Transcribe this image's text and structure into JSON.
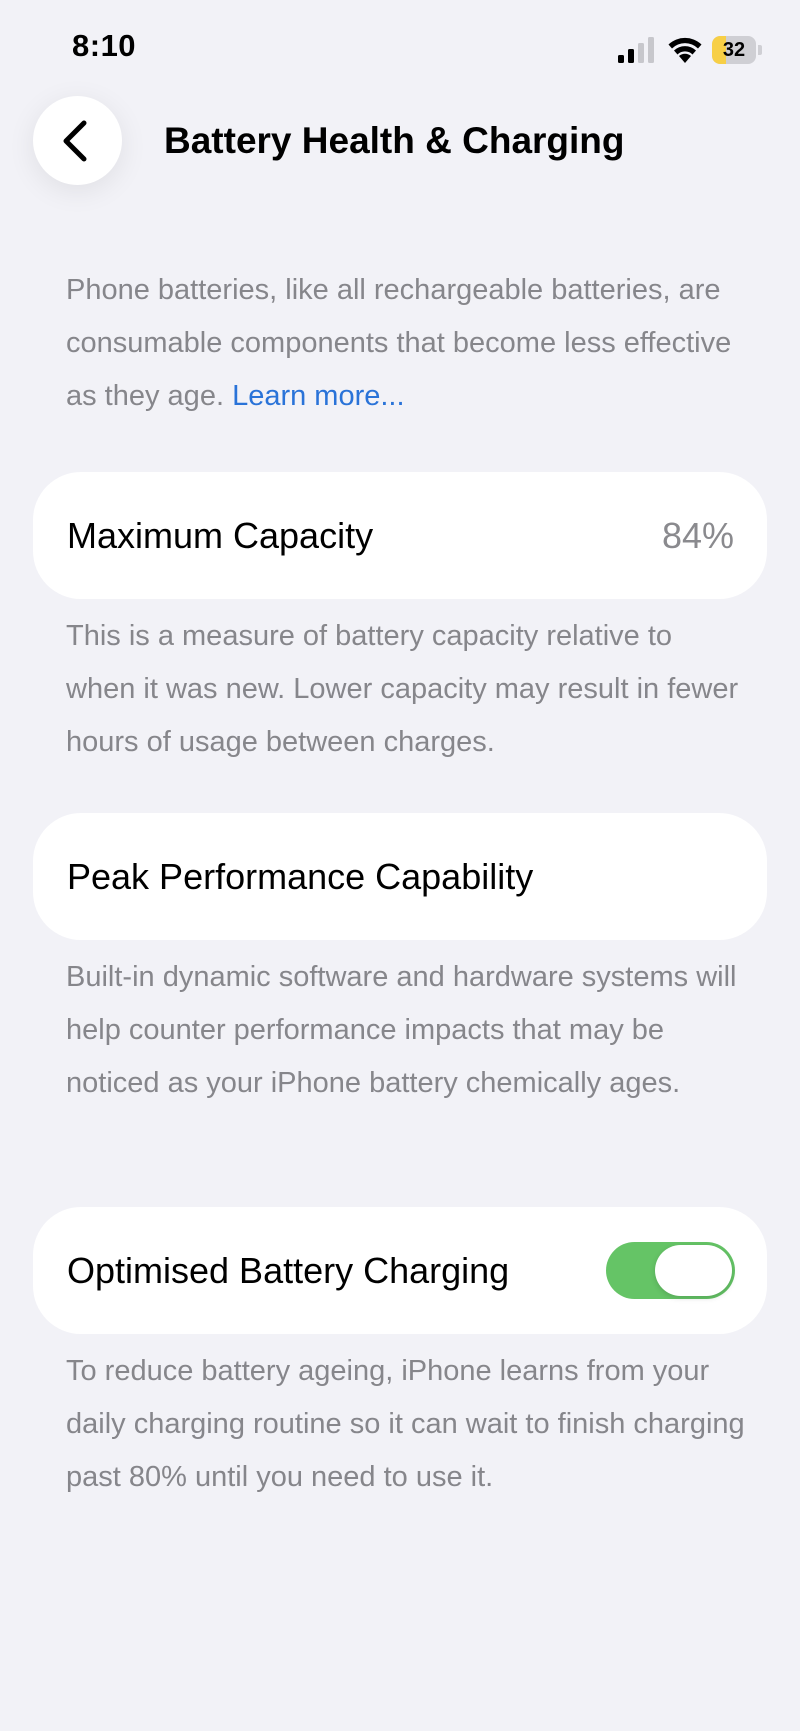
{
  "status_bar": {
    "time": "8:10",
    "battery_level": "32",
    "battery_fraction": 0.32,
    "icons": [
      "cellular-signal-icon",
      "wifi-icon",
      "battery-icon"
    ]
  },
  "nav": {
    "back_icon": "chevron-left-icon",
    "title": "Battery Health & Charging"
  },
  "intro": {
    "text": "Phone batteries, like all rechargeable batteries, are consumable components that become less effective as they age. ",
    "link": "Learn more..."
  },
  "max_capacity": {
    "label": "Maximum Capacity",
    "value": "84%",
    "description": "This is a measure of battery capacity relative to when it was new. Lower capacity may result in fewer hours of usage between charges."
  },
  "peak_performance": {
    "label": "Peak Performance Capability",
    "description": "Built-in dynamic software and hardware systems will help counter performance impacts that may be noticed as your iPhone battery chemically ages."
  },
  "optimised_charging": {
    "label": "Optimised Battery Charging",
    "enabled": true,
    "description": "To reduce battery ageing, iPhone learns from your daily charging routine so it can wait to finish charging past 80% until you need to use it."
  },
  "colors": {
    "background": "#f2f2f7",
    "card": "#ffffff",
    "secondary_text": "#86868b",
    "link": "#2a73d8",
    "toggle_on": "#65c466",
    "battery_low_power": "#f7cf46"
  }
}
